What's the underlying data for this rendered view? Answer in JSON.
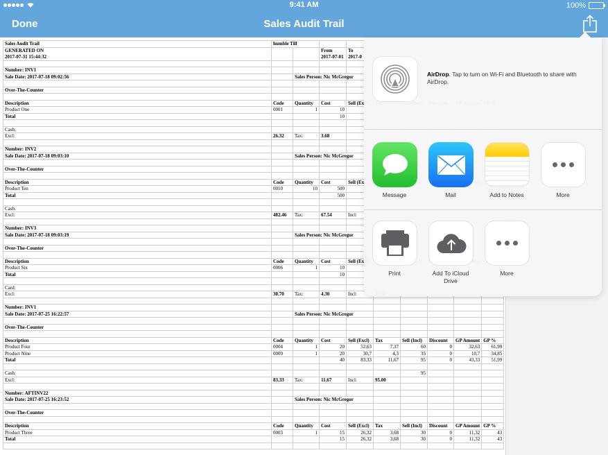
{
  "status_bar": {
    "time": "9:41 AM",
    "battery": "100%",
    "battery_level": 1.0
  },
  "nav": {
    "done_label": "Done",
    "title": "Sales Audit Trail",
    "share_icon": "share-icon"
  },
  "colors": {
    "nav_background": "#62a6dc",
    "battery_fill": "#4cd964",
    "message_green": "#23be2e",
    "mail_blue": "#1a6ff0",
    "notes_yellow": "#ffcc00"
  },
  "share_sheet": {
    "airdrop_title": "AirDrop",
    "airdrop_text": ". Tap to turn on Wi-Fi and Bluetooth to share with AirDrop.",
    "apps": [
      {
        "label": "Message",
        "icon": "message-icon"
      },
      {
        "label": "Mail",
        "icon": "mail-icon"
      },
      {
        "label": "Add to Notes",
        "icon": "notes-icon"
      },
      {
        "label": "More",
        "icon": "more-icon"
      }
    ],
    "actions": [
      {
        "label": "Print",
        "icon": "printer-icon"
      },
      {
        "label": "Add To iCloud Drive",
        "icon": "icloud-upload-icon"
      },
      {
        "label": "More",
        "icon": "more-icon"
      }
    ]
  },
  "report": {
    "header": {
      "title": "Sales Audit Trail",
      "till": "humble Till",
      "generated_label": "GENERATED ON",
      "generated_value": "2017-07-31 15:44:32",
      "from_label": "From",
      "from_value": "2017-07-01",
      "to_label": "To",
      "to_value": "2017-0"
    },
    "columns": [
      "Description",
      "Code",
      "Quantity",
      "Cost",
      "Sell (Excl)",
      "Tax",
      "Sell (Incl)",
      "Discount",
      "GP Amount",
      "GP %"
    ],
    "invoices": [
      {
        "number": "Number: INV1",
        "sale_date": "Sale Date: 2017-07-18 09:02:56",
        "sales_person": "Sales Person: Nic McGregor",
        "type": "Over-The-Counter",
        "items": [
          {
            "desc": "Product One",
            "code": "0001",
            "qty": "1",
            "cost": "10",
            "sell_excl": "",
            "tax": "",
            "sell_incl": "",
            "discount": "",
            "gp_amount": "",
            "gp_pct": ""
          }
        ],
        "total": {
          "cost": "10",
          "sell_excl": "",
          "tax": "",
          "sell_incl": "",
          "discount": "",
          "gp_amount": "",
          "gp_pct": ""
        },
        "payment": "Cash:",
        "payment_amount": "",
        "excl": "26.32",
        "tax": "3.68",
        "incl": ""
      },
      {
        "number": "Number: INV2",
        "sale_date": "Sale Date: 2017-07-18 09:03:10",
        "sales_person": "Sales Person: Nic McGregor",
        "type": "Over-The-Counter",
        "items": [
          {
            "desc": "Product Ten",
            "code": "0010",
            "qty": "10",
            "cost": "500",
            "sell_excl": "",
            "tax": "",
            "sell_incl": "",
            "discount": "",
            "gp_amount": "",
            "gp_pct": ""
          }
        ],
        "total": {
          "cost": "500",
          "sell_excl": "",
          "tax": "",
          "sell_incl": "",
          "discount": "",
          "gp_amount": "",
          "gp_pct": ""
        },
        "payment": "Cash:",
        "payment_amount": "",
        "excl": "482.46",
        "tax": "67.54",
        "incl": "Incl:"
      },
      {
        "number": "Number: INV3",
        "sale_date": "Sale Date: 2017-07-18 09:03:19",
        "sales_person": "Sales Person: Nic McGregor",
        "type": "Over-The-Counter",
        "items": [
          {
            "desc": "Product Six",
            "code": "0006",
            "qty": "1",
            "cost": "10",
            "sell_excl": "",
            "tax": "",
            "sell_incl": "",
            "discount": "",
            "gp_amount": "",
            "gp_pct": ""
          }
        ],
        "total": {
          "cost": "10",
          "sell_excl": "",
          "tax": "",
          "sell_incl": "",
          "discount": "",
          "gp_amount": "",
          "gp_pct": ""
        },
        "payment": "Card:",
        "payment_amount": "",
        "excl": "30.70",
        "tax": "4.30",
        "incl": "Incl:",
        "incl_value": "35.00"
      },
      {
        "number": "Number: INV1",
        "sale_date": "Sale Date: 2017-07-25 16:22:57",
        "sales_person": "Sales Person: Nic McGregor",
        "type": "Over-The-Counter",
        "items": [
          {
            "desc": "Product Four",
            "code": "0004",
            "qty": "1",
            "cost": "20",
            "sell_excl": "52,63",
            "tax": "7,37",
            "sell_incl": "60",
            "discount": "0",
            "gp_amount": "32,63",
            "gp_pct": "61,99"
          },
          {
            "desc": "Product Nine",
            "code": "0009",
            "qty": "1",
            "cost": "20",
            "sell_excl": "30,7",
            "tax": "4,3",
            "sell_incl": "35",
            "discount": "0",
            "gp_amount": "10,7",
            "gp_pct": "34,85"
          }
        ],
        "total": {
          "cost": "40",
          "sell_excl": "83,33",
          "tax": "11,67",
          "sell_incl": "95",
          "discount": "0",
          "gp_amount": "43,33",
          "gp_pct": "51,99"
        },
        "payment": "Cash:",
        "payment_amount": "95",
        "excl": "83.33",
        "tax": "11.67",
        "incl": "Incl:",
        "incl_value": "95.00"
      },
      {
        "number": "Number: AFTINV22",
        "sale_date": "Sale Date: 2017-07-25 16:23:52",
        "sales_person": "Sales Person: Nic McGregor",
        "type": "Over-The-Counter",
        "items": [
          {
            "desc": "Product Three",
            "code": "0003",
            "qty": "1",
            "cost": "15",
            "sell_excl": "26,32",
            "tax": "3,68",
            "sell_incl": "30",
            "discount": "0",
            "gp_amount": "11,32",
            "gp_pct": "43"
          }
        ],
        "total": {
          "cost": "15",
          "sell_excl": "26,32",
          "tax": "3,68",
          "sell_incl": "30",
          "discount": "0",
          "gp_amount": "11,32",
          "gp_pct": "43"
        }
      }
    ],
    "labels": {
      "total": "Total",
      "excl": "Excl:",
      "tax": "Tax:"
    }
  }
}
